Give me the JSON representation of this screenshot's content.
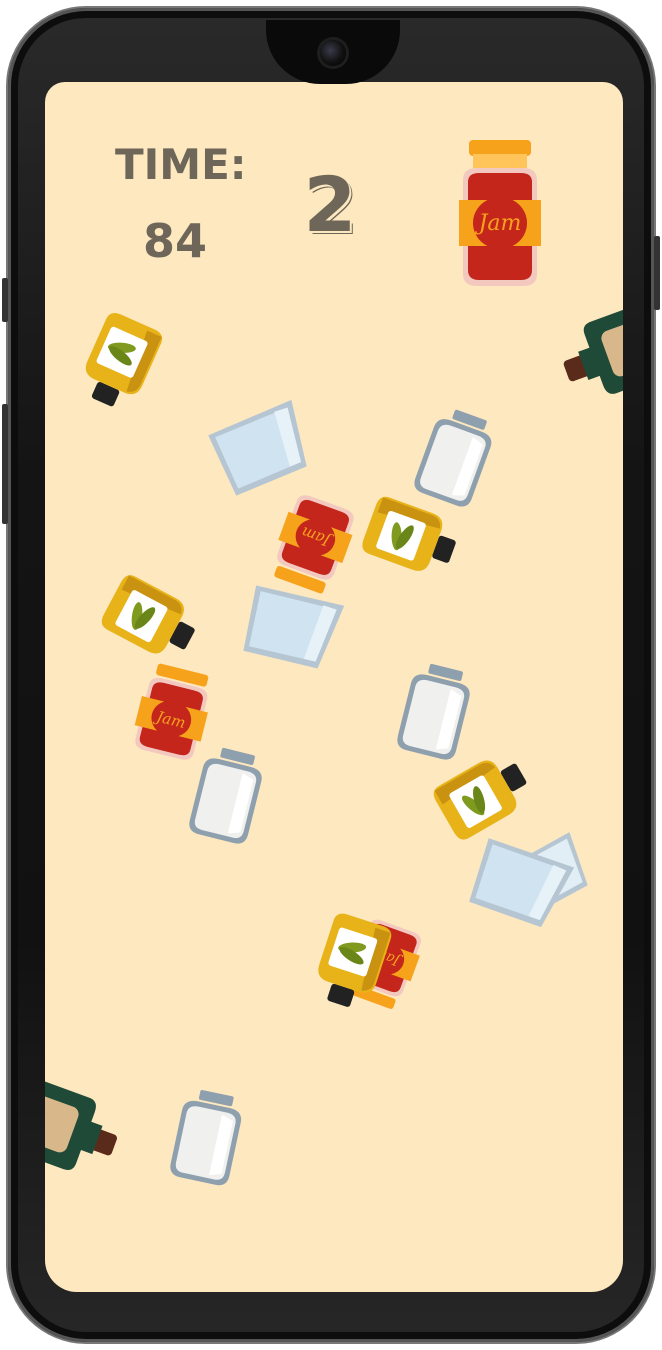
{
  "hud": {
    "time_label": "TIME:",
    "time_value": "84",
    "score": "2"
  },
  "target": {
    "icon": "jam-jar-icon",
    "label": "Jam"
  },
  "items": [
    {
      "type": "mustard-bottle",
      "label": ""
    },
    {
      "type": "dark-bottle",
      "label": ""
    },
    {
      "type": "water-glass",
      "label": ""
    },
    {
      "type": "empty-jar",
      "label": ""
    },
    {
      "type": "jam-jar",
      "label": "Jam"
    },
    {
      "type": "mustard-bottle",
      "label": ""
    },
    {
      "type": "mustard-bottle",
      "label": ""
    },
    {
      "type": "water-glass",
      "label": ""
    },
    {
      "type": "jam-jar",
      "label": "Jam"
    },
    {
      "type": "empty-jar",
      "label": ""
    },
    {
      "type": "empty-jar",
      "label": ""
    },
    {
      "type": "mustard-bottle",
      "label": ""
    },
    {
      "type": "water-glass",
      "label": ""
    },
    {
      "type": "water-glass",
      "label": ""
    },
    {
      "type": "jam-jar",
      "label": "Jam"
    },
    {
      "type": "mustard-bottle",
      "label": ""
    },
    {
      "type": "dark-bottle",
      "label": ""
    },
    {
      "type": "empty-jar",
      "label": ""
    }
  ],
  "colors": {
    "background": "#fde8bf",
    "hud_text": "#6e6658",
    "jam_red": "#c4261c",
    "jam_orange": "#f7a21b",
    "mustard": "#e8b319",
    "glass": "#cfe3f1"
  }
}
